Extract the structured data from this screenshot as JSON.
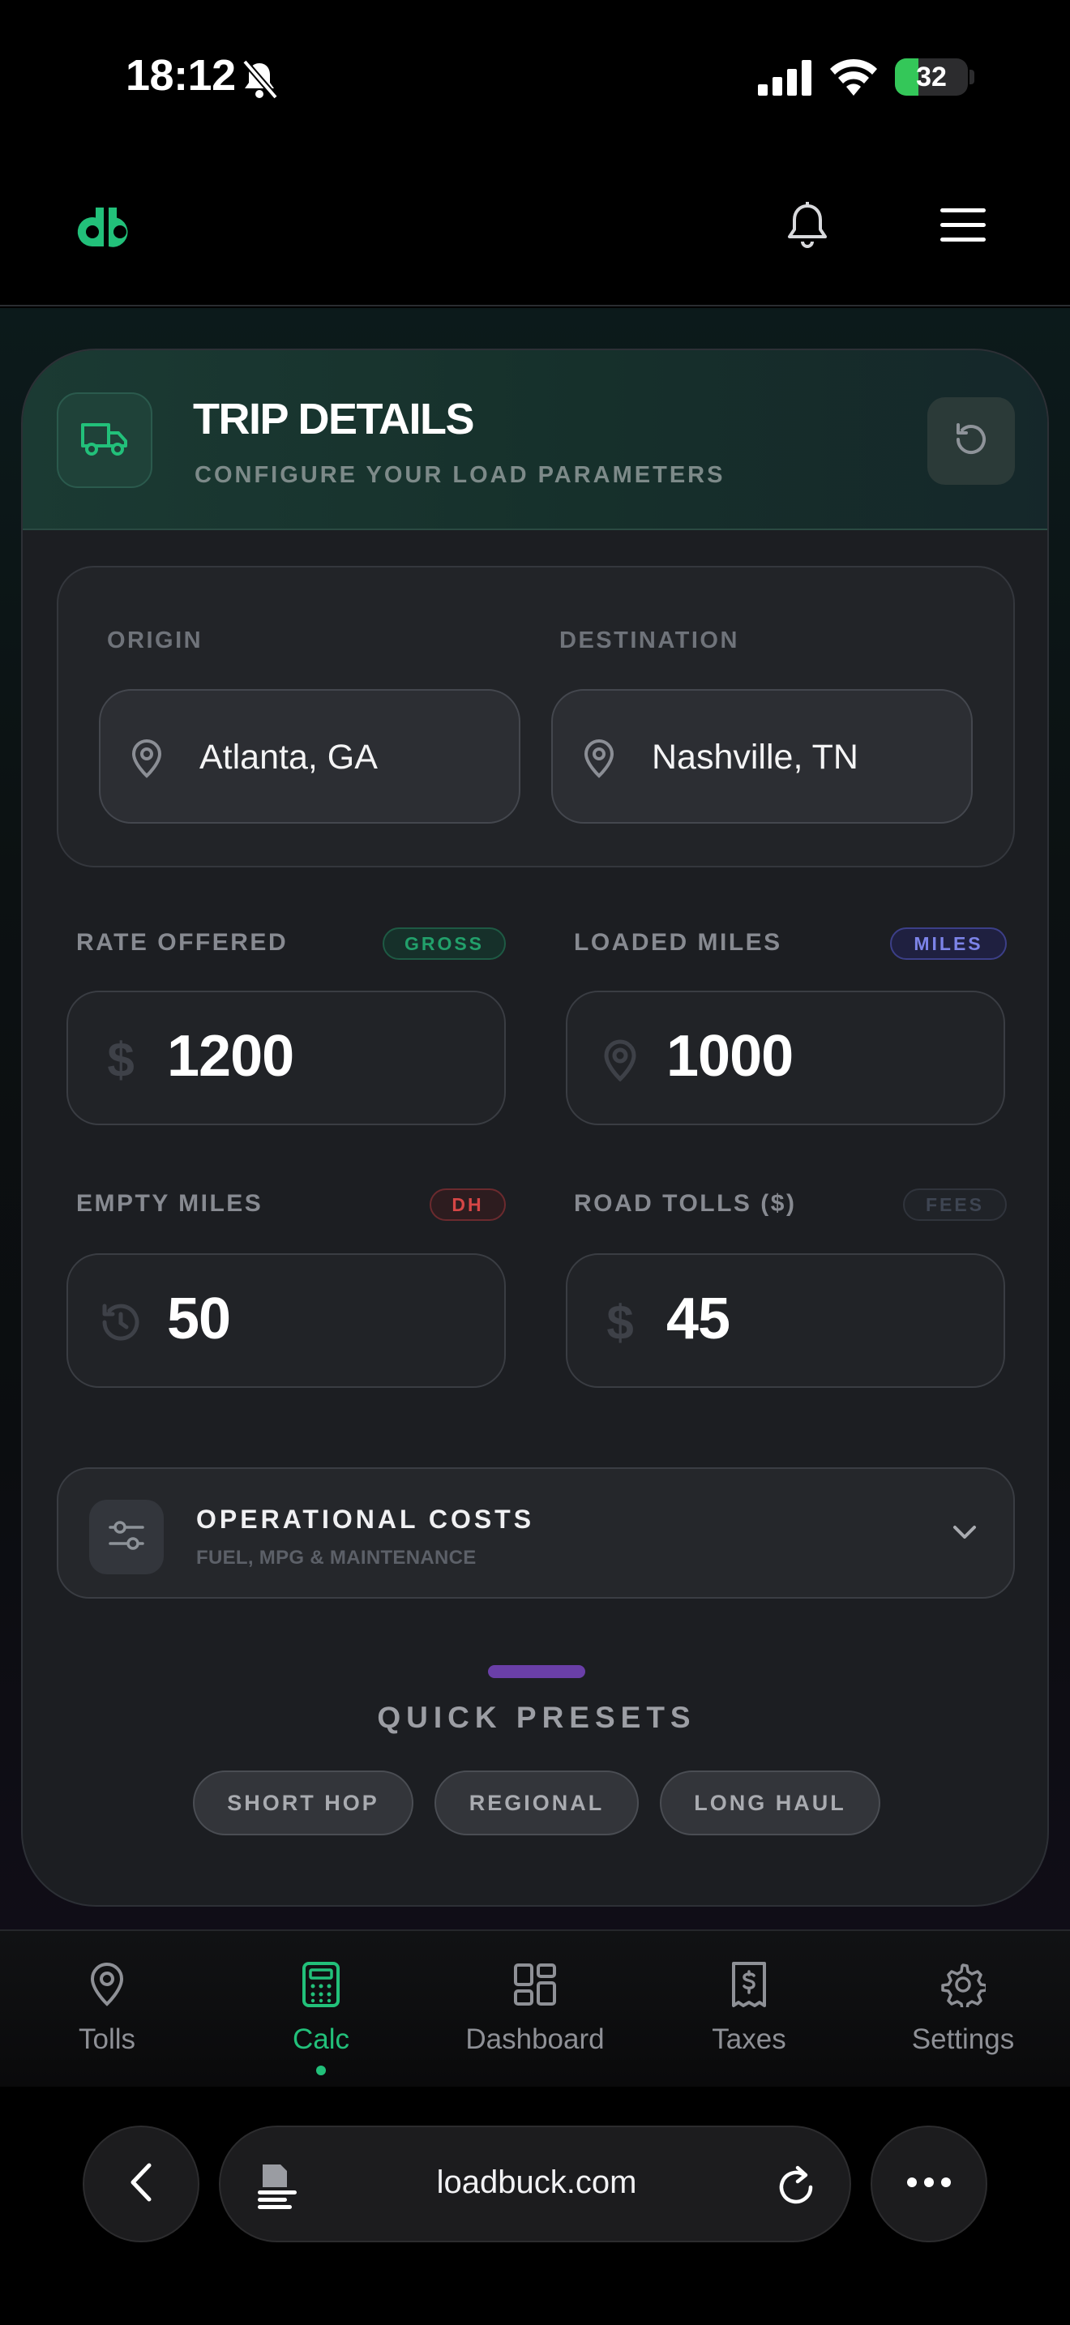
{
  "status_bar": {
    "time": "18:12",
    "battery": "32",
    "battery_level": 0.32
  },
  "header": {
    "logo_icon": "db-logo-icon",
    "notification_icon": "bell-icon",
    "menu_icon": "hamburger-menu-icon"
  },
  "card": {
    "title": "TRIP DETAILS",
    "subtitle": "CONFIGURE YOUR LOAD PARAMETERS",
    "header_icon": "truck-icon",
    "reset_icon": "reset-icon"
  },
  "route": {
    "origin_label": "ORIGIN",
    "origin_value": "Atlanta, GA",
    "destination_label": "DESTINATION",
    "destination_value": "Nashville, TN"
  },
  "fields": {
    "rate": {
      "label": "RATE OFFERED",
      "badge": "GROSS",
      "value": "1200",
      "icon": "$"
    },
    "loaded_miles": {
      "label": "LOADED MILES",
      "badge": "MILES",
      "value": "1000"
    },
    "empty_miles": {
      "label": "EMPTY MILES",
      "badge": "DH",
      "value": "50"
    },
    "tolls": {
      "label": "ROAD TOLLS ($)",
      "badge": "FEES",
      "value": "45",
      "icon": "$"
    }
  },
  "operational": {
    "title": "OPERATIONAL COSTS",
    "subtitle": "FUEL, MPG & MAINTENANCE"
  },
  "presets": {
    "title": "QUICK PRESETS",
    "items": [
      "SHORT HOP",
      "REGIONAL",
      "LONG HAUL"
    ]
  },
  "nav": {
    "items": [
      {
        "label": "Tolls",
        "icon": "map-pin-icon"
      },
      {
        "label": "Calc",
        "icon": "calculator-icon",
        "active": true
      },
      {
        "label": "Dashboard",
        "icon": "grid-icon"
      },
      {
        "label": "Taxes",
        "icon": "receipt-icon"
      },
      {
        "label": "Settings",
        "icon": "gear-icon"
      }
    ]
  },
  "browser": {
    "url": "loadbuck.com"
  },
  "colors": {
    "accent_green": "#22c07a",
    "background": "#000000",
    "card": "#1c1e22",
    "preset_handle": "#6a3fa8"
  }
}
